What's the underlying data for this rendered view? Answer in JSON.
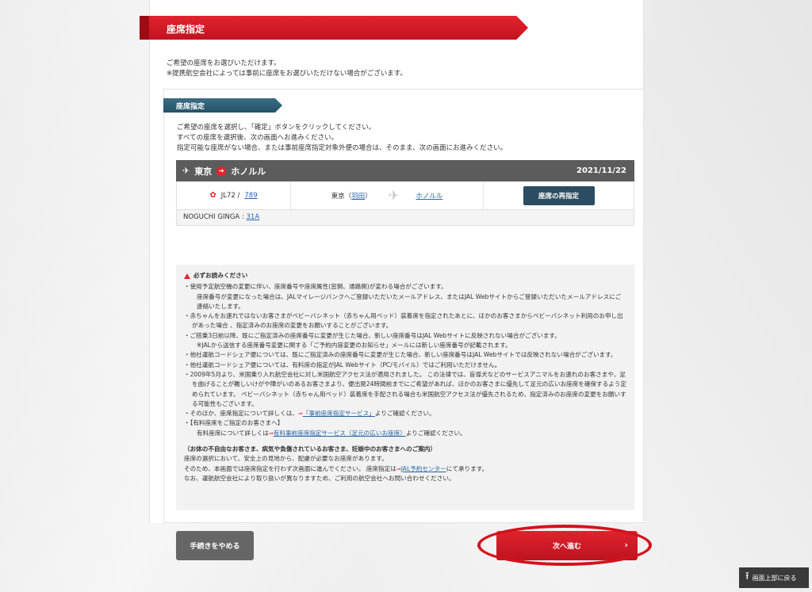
{
  "page": {
    "title": "座席指定",
    "intro_lines": [
      "ご希望の座席をお選びいただけます。",
      "※提携航空会社によっては事前に座席をお選びいただけない場合がございます。"
    ]
  },
  "section": {
    "title": "座席指定",
    "desc_lines": [
      "ご希望の座席を選択し、「確定」ボタンをクリックしてください。",
      "すべての座席を選択後、次の画面へお進みください。",
      "指定可能な座席がない場合、または事前座席指定対象外便の場合は、そのまま、次の画面にお進みください。"
    ]
  },
  "flight": {
    "origin": "東京",
    "destination": "ホノルル",
    "date": "2021/11/22",
    "flight_no": "JL72 /",
    "aircraft": "789",
    "origin_city": "東京（",
    "origin_airport": "羽田",
    "origin_close": "）",
    "dest_link": "ホノルル",
    "reselect_label": "座席の再指定"
  },
  "passenger": {
    "name": "NOGUCHI GINGA :",
    "seat": "31A"
  },
  "notice": {
    "heading": "必ずお読みください",
    "l1": "・使用予定航空機の変更に伴い、座席番号や座席属性(窓側、通路側)が変わる場合がございます。",
    "l1b": "座席番号が変更になった場合は、JALマイレージバンクへご登録いただいたメールアドレス、またはJAL Webサイトからご登録いただいたメールアドレスにご連絡いたします。",
    "l2": "・赤ちゃんをお連れではないお客さまがベビーバシネット（赤ちゃん用ベッド）装着席を指定されたあとに、ほかのお客さまからベビーバシネット利用のお申し出があった場合 、指定済みのお座席の変更をお願いすることがございます。",
    "l3": "・ご搭乗3日前以降、既にご指定済みの座席番号に変更が生じた場合、新しい座席番号はJAL Webサイトに反映されない場合がございます。",
    "l3b": "※JALから送信する座席番号変更に関する「ご予約内容変更のお知らせ」メールには新しい座席番号が記載されます。",
    "l4": "・他社運航コードシェア便については、既にご指定済みの座席番号に変更が生じた場合、新しい座席番号はJAL Webサイトでは反映されない場合がございます。",
    "l5": "・他社運航コードシェア便については、有料席の指定がJAL Webサイト（PC/モバイル）ではご利用いただけません。",
    "l6": "・2009年5月より、米国乗り入れ航空会社に対し米国航空アクセス法が適用されました。 この法律では、盲導犬などのサービスアニマルをお連れのお客さまや、足を曲げることが難しいけがや障がいのあるお客さまより、便出発24時間前までにご希望があれば、ほかのお客さまに優先して足元の広いお座席を確保するよう定められています。 ベビーバシネット（赤ちゃん用ベッド）装着席を手配される場合も米国航空アクセス法が優先されるため、指定済みのお座席の変更をお願いする可能性もございます。",
    "l7_pre": "・そのほか、座席指定について詳しくは、",
    "l7_link": "「事前座席指定サービス」",
    "l7_post": "よりご確認ください。",
    "l8": "・【有料座席をご指定のお客さまへ】",
    "l8b_pre": "有料座席について詳しくは",
    "l8b_link": "有料事前座席指定サービス（足元の広いお座席）",
    "l8b_post": "よりご確認ください。",
    "sub_heading": "（お体の不自由なお客さま、病気や負傷されているお客さま、妊娠中のお客さまへのご案内）",
    "p1": "座席の選択において、安全上の見地から、配慮が必要なお座席があります。",
    "p2_pre": "そのため、本画面では座席指定を行わず次画面に進んでください。 座席指定は",
    "p2_link": "JAL予約センター",
    "p2_post": "にて承ります。",
    "p3": "なお、運航航空会社により取り扱いが異なりますため、ご利用の航空会社へお問い合わせください。"
  },
  "actions": {
    "cancel_label": "手続きをやめる",
    "next_label": "次へ進む",
    "next_chevron": "›",
    "back_top_label": "画面上部に戻る"
  },
  "colors": {
    "accent_red": "#e2232e",
    "section_blue": "#245268",
    "button_gray": "#666666"
  }
}
